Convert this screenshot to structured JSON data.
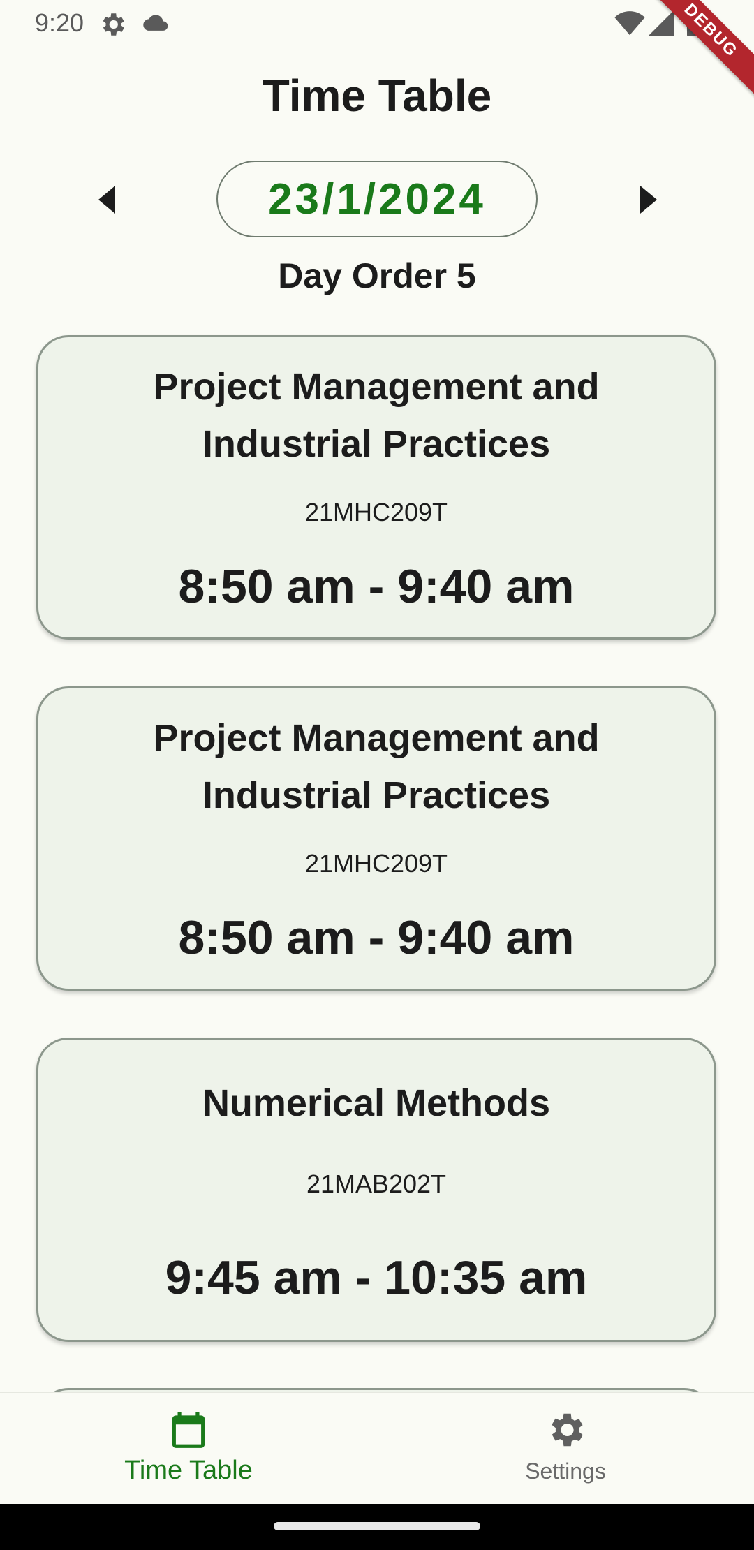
{
  "status_bar": {
    "time": "9:20",
    "icons": [
      "gear-icon",
      "cloud-icon",
      "wifi-icon",
      "signal-icon",
      "battery-icon"
    ]
  },
  "debug_banner": "DEBUG",
  "header": {
    "title": "Time Table",
    "date": "23/1/2024",
    "day_order": "Day Order 5"
  },
  "classes": [
    {
      "title": "Project Management and Industrial Practices",
      "code": "21MHC209T",
      "time": "8:50 am - 9:40 am"
    },
    {
      "title": "Project Management and Industrial Practices",
      "code": "21MHC209T",
      "time": "8:50 am - 9:40 am"
    },
    {
      "title": "Numerical Methods",
      "code": "21MAB202T",
      "time": "9:45 am - 10:35 am"
    }
  ],
  "bottom_nav": {
    "items": [
      {
        "label": "Time Table",
        "icon": "calendar-icon",
        "active": true
      },
      {
        "label": "Settings",
        "icon": "settings-icon",
        "active": false
      }
    ]
  },
  "colors": {
    "accent": "#1a7a1a",
    "card_bg": "#eef3ea",
    "page_bg": "#fafbf5",
    "debug": "#b3262d"
  }
}
